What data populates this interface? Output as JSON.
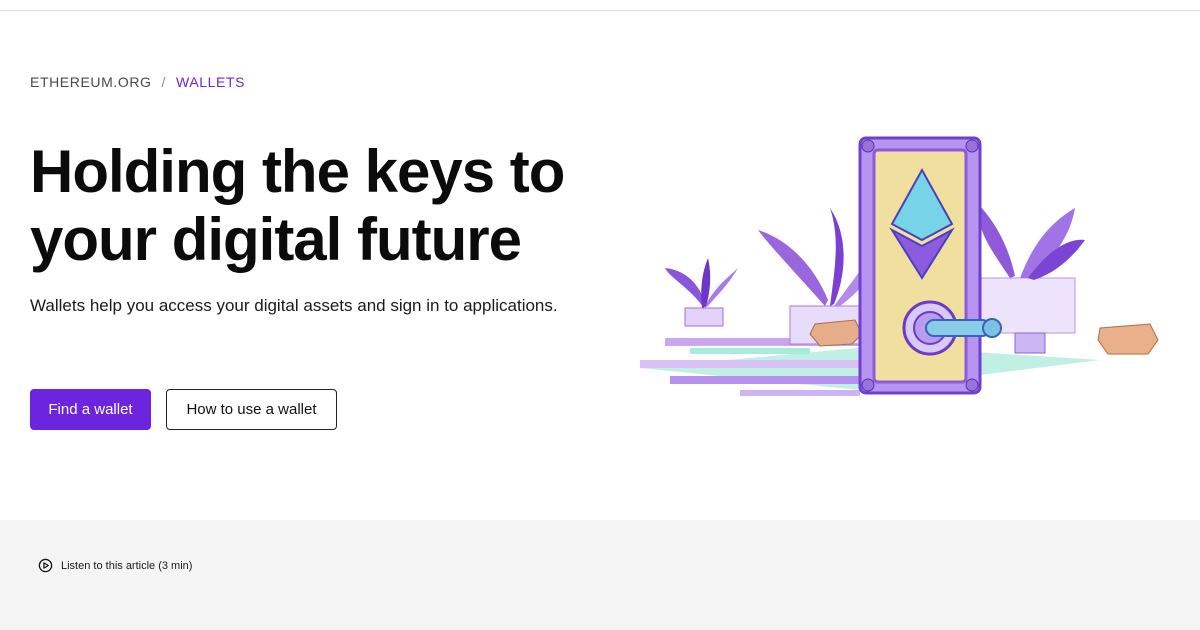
{
  "breadcrumb": {
    "home": "ETHEREUM.ORG",
    "separator": "/",
    "current": "WALLETS"
  },
  "hero": {
    "title": "Holding the keys to your digital future",
    "subtitle": "Wallets help you access your digital assets and sign in to applications.",
    "primary_button": "Find a wallet",
    "secondary_button": "How to use a wallet",
    "illustration_icon": "wallet-door-illustration"
  },
  "listen": {
    "label": "Listen to this article (3 min)",
    "icon": "play-circle-icon"
  },
  "colors": {
    "accent": "#6c24df",
    "lower_background": "#f5f5f5"
  }
}
